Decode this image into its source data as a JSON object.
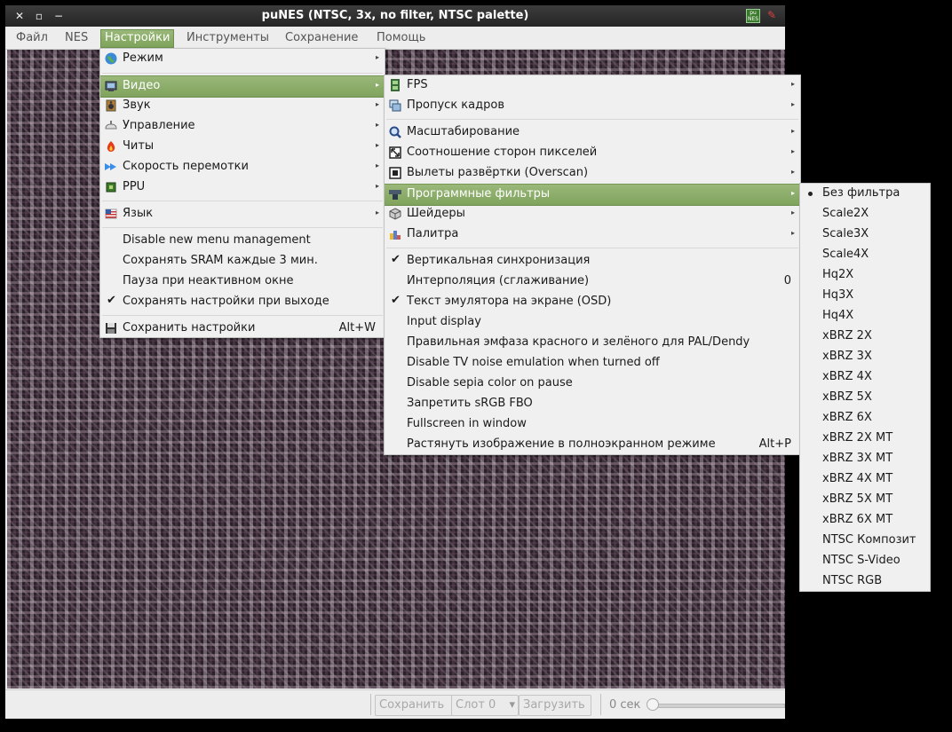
{
  "window": {
    "title": "puNES (NTSC, 3x, no filter, NTSC palette)",
    "app_icon_text": "pu\nNES"
  },
  "menubar": [
    "Файл",
    "NES",
    "Настройки",
    "Инструменты",
    "Сохранение",
    "Помощь"
  ],
  "settings_menu": {
    "items": [
      {
        "label": "Режим",
        "icon": "globe-icon",
        "submenu": true
      },
      {
        "label": "Видео",
        "icon": "monitor-icon",
        "submenu": true,
        "highlighted": true
      },
      {
        "label": "Звук",
        "icon": "speaker-icon",
        "submenu": true
      },
      {
        "label": "Управление",
        "icon": "gamepad-icon",
        "submenu": true
      },
      {
        "label": "Читы",
        "icon": "fire-icon",
        "submenu": true
      },
      {
        "label": "Скорость перемотки",
        "icon": "fast-forward-icon",
        "submenu": true
      },
      {
        "label": "PPU",
        "icon": "chip-icon",
        "submenu": true
      },
      {
        "label": "Язык",
        "icon": "flag-icon",
        "submenu": true
      },
      {
        "label": "Disable new menu management"
      },
      {
        "label": "Сохранять SRAM каждые 3 мин."
      },
      {
        "label": "Пауза при неактивном окне"
      },
      {
        "label": "Сохранять настройки при выходе",
        "checked": true
      },
      {
        "label": "Сохранить настройки",
        "icon": "floppy-icon",
        "shortcut": "Alt+W"
      }
    ]
  },
  "video_menu": {
    "items": [
      {
        "label": "FPS",
        "icon": "film-icon",
        "submenu": true
      },
      {
        "label": "Пропуск кадров",
        "icon": "frames-icon",
        "submenu": true
      },
      {
        "label": "Масштабирование",
        "icon": "magnifier-icon",
        "submenu": true
      },
      {
        "label": "Соотношение сторон пикселей",
        "icon": "resize-icon",
        "submenu": true
      },
      {
        "label": "Вылеты развёртки (Overscan)",
        "icon": "overscan-icon",
        "submenu": true
      },
      {
        "label": "Программные фильтры",
        "icon": "filter-icon",
        "submenu": true,
        "highlighted": true
      },
      {
        "label": "Шейдеры",
        "icon": "cube-icon",
        "submenu": true
      },
      {
        "label": "Палитра",
        "icon": "palette-icon",
        "submenu": true
      },
      {
        "label": "Вертикальная синхронизация",
        "checked": true
      },
      {
        "label": "Интерполяция (сглаживание)",
        "shortcut": "0"
      },
      {
        "label": "Текст эмулятора на экране (OSD)",
        "checked": true
      },
      {
        "label": "Input display"
      },
      {
        "label": "Правильная эмфаза красного и зелёного для PAL/Dendy"
      },
      {
        "label": "Disable TV noise emulation when turned off"
      },
      {
        "label": "Disable sepia color on pause"
      },
      {
        "label": "Запретить sRGB FBO"
      },
      {
        "label": "Fullscreen in window"
      },
      {
        "label": "Растянуть изображение в полноэкранном режиме",
        "shortcut": "Alt+P"
      }
    ]
  },
  "filters_menu": {
    "items": [
      {
        "label": "Без фильтра",
        "selected": true
      },
      {
        "label": "Scale2X"
      },
      {
        "label": "Scale3X"
      },
      {
        "label": "Scale4X"
      },
      {
        "label": "Hq2X"
      },
      {
        "label": "Hq3X"
      },
      {
        "label": "Hq4X"
      },
      {
        "label": "xBRZ 2X"
      },
      {
        "label": "xBRZ 3X"
      },
      {
        "label": "xBRZ 4X"
      },
      {
        "label": "xBRZ 5X"
      },
      {
        "label": "xBRZ 6X"
      },
      {
        "label": "xBRZ 2X MT"
      },
      {
        "label": "xBRZ 3X MT"
      },
      {
        "label": "xBRZ 4X MT"
      },
      {
        "label": "xBRZ 5X MT"
      },
      {
        "label": "xBRZ 6X MT"
      },
      {
        "label": "NTSC Композит"
      },
      {
        "label": "NTSC S-Video"
      },
      {
        "label": "NTSC RGB"
      }
    ]
  },
  "statusbar": {
    "save_label": "Сохранить",
    "slot_label": "Слот 0",
    "load_label": "Загрузить",
    "time_label": "0 сек"
  },
  "colors": {
    "highlight": "#8fae6b",
    "titlebar": "#2e2e2e"
  }
}
